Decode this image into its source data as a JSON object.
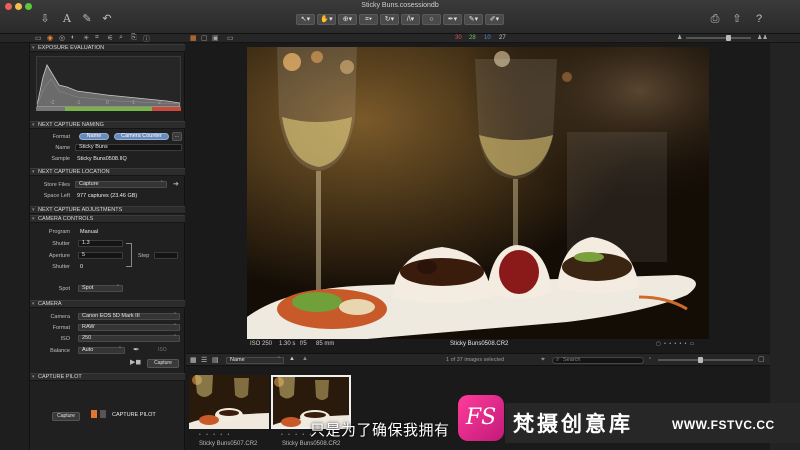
{
  "window": {
    "title": "Sticky Buns.cosessiondb"
  },
  "header": {
    "counts": {
      "red": "30",
      "green": "28",
      "blue": "10",
      "other": "27"
    },
    "colors": {
      "red": "#e05050",
      "green": "#6dc26d",
      "blue": "#5a86d8",
      "other": "#c8c8c8"
    }
  },
  "exposure": {
    "title": "EXPOSURE EVALUATION",
    "scale": [
      "-2",
      "-1",
      "0",
      "1",
      "2"
    ]
  },
  "naming": {
    "title": "NEXT CAPTURE NAMING",
    "format_label": "Format",
    "format_tokens": [
      "Name",
      "Camera Counter"
    ],
    "more_label": "...",
    "name_label": "Name",
    "name_value": "Sticky Buns",
    "sample_label": "Sample",
    "sample_value": "Sticky Buns0508.IIQ"
  },
  "location": {
    "title": "NEXT CAPTURE LOCATION",
    "store_label": "Store Files",
    "store_value": "Capture",
    "space_label": "Space Left",
    "space_value": "977 captures (23.46 GB)"
  },
  "adjustments": {
    "title": "NEXT CAPTURE ADJUSTMENTS"
  },
  "camera_controls": {
    "title": "CAMERA CONTROLS",
    "program_label": "Program",
    "program_value": "Manual",
    "shutter_label": "Shutter",
    "shutter_value": "1.3",
    "aperture_label": "Aperture",
    "aperture_value": "5",
    "shutter2_label": "Shutter",
    "shutter2_value": "0",
    "step_label": "Step",
    "spot1": "Spot",
    "spot2": "Spot"
  },
  "camera": {
    "title": "CAMERA",
    "camera_label": "Camera",
    "camera_value": "Canon EOS 5D Mark III",
    "format_label": "Format",
    "format_value": "RAW",
    "iso_label": "ISO",
    "iso_value": "250",
    "balance_label": "Balance",
    "balance_value": "Auto",
    "capture_button": "Capture"
  },
  "capture_pilot": {
    "title": "CAPTURE PILOT",
    "capture_button": "Capture",
    "pilot_label": "CAPTURE PILOT"
  },
  "viewer": {
    "meta": {
      "iso": "ISO 250",
      "shutter": "1.30 s",
      "aperture": "f/5",
      "focal": "85 mm"
    },
    "filename": "Sticky Buns0508.CR2"
  },
  "filmbar": {
    "sort_value": "Name",
    "count_text": "1 of 37 images selected",
    "search_placeholder": "Search"
  },
  "thumbnails": [
    {
      "label": "Sticky Buns0507.CR2"
    },
    {
      "label": "Sticky Buns0508.CR2"
    }
  ],
  "overlay": {
    "subtitle": "只是为了确保我拥有",
    "watermark_logo": "FS",
    "watermark_text": "梵摄创意库",
    "watermark_url": "WWW.FSTVC.CC"
  }
}
